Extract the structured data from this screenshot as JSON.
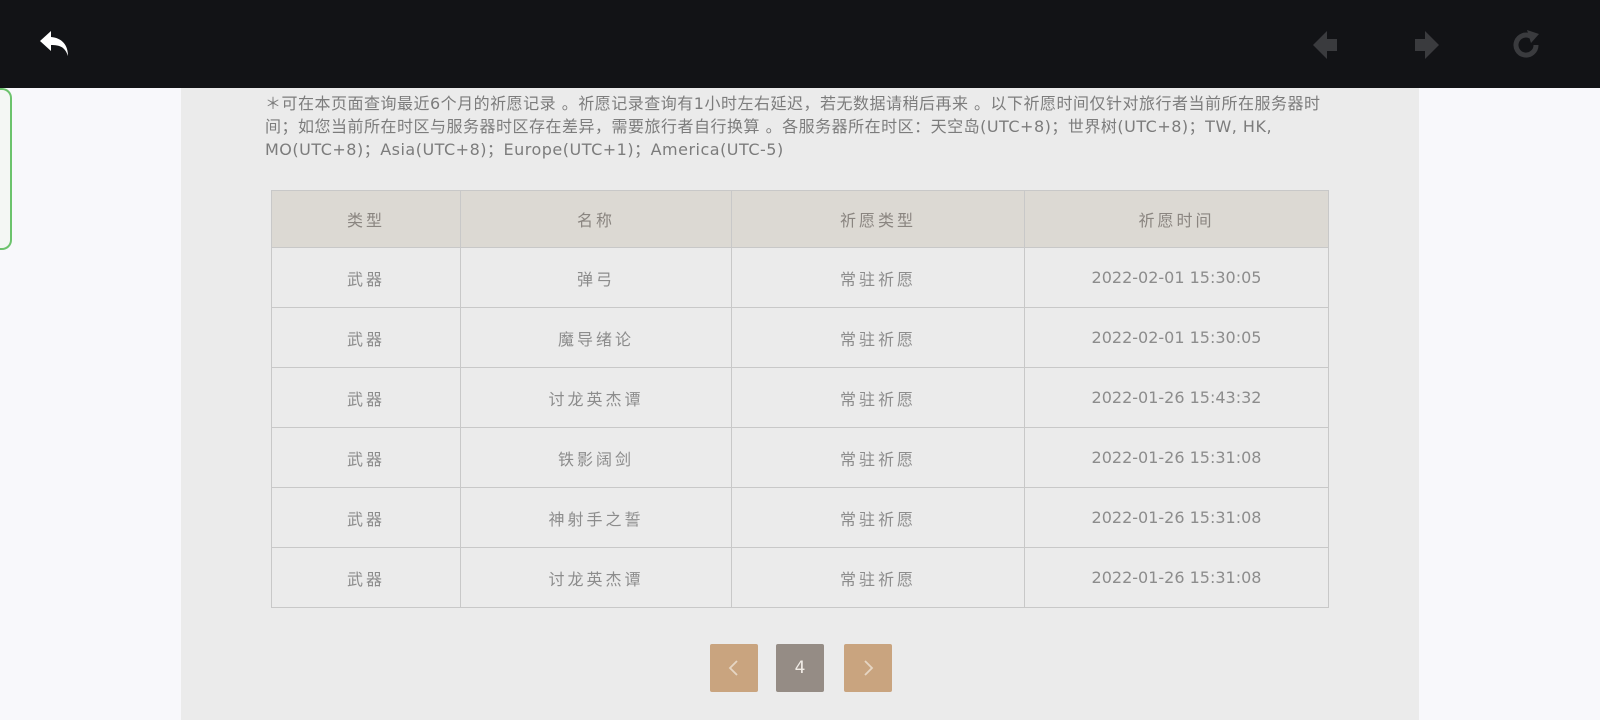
{
  "toolbar": {
    "back_icon": "back-arrow-icon",
    "prev_icon": "nav-back-icon",
    "forward_icon": "nav-forward-icon",
    "refresh_icon": "refresh-icon"
  },
  "notice": {
    "text": "＊可在本页面查询最近6个月的祈愿记录 。祈愿记录查询有1小时左右延迟，若无数据请稍后再来 。以下祈愿时间仅针对旅行者当前所在服务器时间；如您当前所在时区与服务器时区存在差异，需要旅行者自行换算 。各服务器所在时区：天空岛(UTC+8)；世界树(UTC+8)；TW, HK, MO(UTC+8)；Asia(UTC+8)；Europe(UTC+1)；America(UTC-5)"
  },
  "table": {
    "headers": [
      "类型",
      "名称",
      "祈愿类型",
      "祈愿时间"
    ],
    "rows": [
      [
        "武器",
        "弹弓",
        "常驻祈愿",
        "2022-02-01 15:30:05"
      ],
      [
        "武器",
        "魔导绪论",
        "常驻祈愿",
        "2022-02-01 15:30:05"
      ],
      [
        "武器",
        "讨龙英杰谭",
        "常驻祈愿",
        "2022-01-26 15:43:32"
      ],
      [
        "武器",
        "铁影阔剑",
        "常驻祈愿",
        "2022-01-26 15:31:08"
      ],
      [
        "武器",
        "神射手之誓",
        "常驻祈愿",
        "2022-01-26 15:31:08"
      ],
      [
        "武器",
        "讨龙英杰谭",
        "常驻祈愿",
        "2022-01-26 15:31:08"
      ]
    ]
  },
  "pagination": {
    "current_page": "4",
    "prev_icon": "chevron-left-icon",
    "next_icon": "chevron-right-icon"
  },
  "colors": {
    "topbar": "#121316",
    "panel": "#ebebeb",
    "header_row": "#dcd9d3",
    "pager_button": "#c9a47f",
    "pager_current": "#958c85",
    "side_tab_border": "#6cc36c"
  }
}
